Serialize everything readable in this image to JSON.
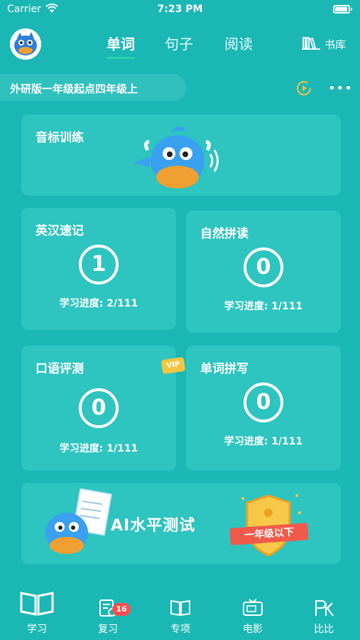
{
  "status_bar": {
    "carrier": "Carrier",
    "time": "7:23 PM"
  },
  "nav": {
    "tabs": [
      {
        "label": "单词",
        "active": true
      },
      {
        "label": "句子",
        "active": false
      },
      {
        "label": "阅读",
        "active": false
      }
    ],
    "library_label": "书库"
  },
  "book": {
    "name": "外研版一年级起点四年级上"
  },
  "cards": {
    "phonetics": {
      "title": "音标训练"
    },
    "ehsj": {
      "title": "英汉速记",
      "count": "1",
      "progress": "学习进度: 2/111"
    },
    "zrpd": {
      "title": "自然拼读",
      "count": "0",
      "progress": "学习进度: 1/111"
    },
    "kypc": {
      "title": "口语评测",
      "count": "0",
      "progress": "学习进度: 1/111",
      "vip_label": "VIP"
    },
    "dcpx": {
      "title": "单词拼写",
      "count": "0",
      "progress": "学习进度: 1/111"
    },
    "ai_test": {
      "title": "AI水平测试",
      "level": "一年级以下"
    }
  },
  "tab_bar": {
    "items": [
      {
        "label": "学习",
        "active": true
      },
      {
        "label": "复习",
        "badge": "16"
      },
      {
        "label": "专项"
      },
      {
        "label": "电影"
      },
      {
        "label": "比比"
      }
    ]
  },
  "colors": {
    "background": "#1bb7b4",
    "card": "#2ec4c0",
    "accent": "#26d6a8",
    "badge": "#ff4d4d",
    "gold": "#f5c542",
    "mascot": "#3aa0f0"
  }
}
